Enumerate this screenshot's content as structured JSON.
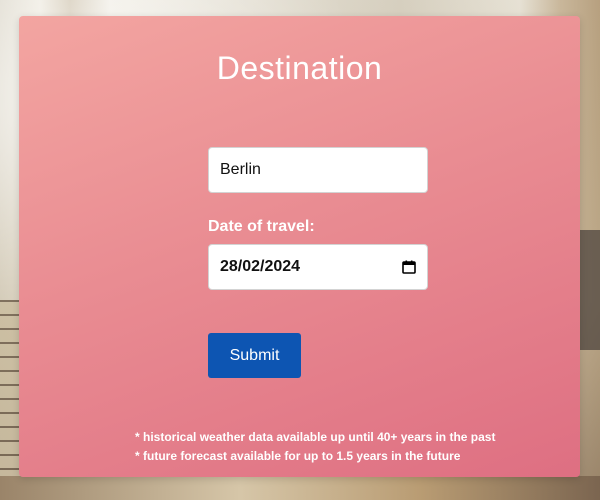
{
  "form": {
    "title": "Destination",
    "city_value": "Berlin",
    "date_label": "Date of travel:",
    "date_value": "28/02/2024",
    "submit_label": "Submit",
    "notes": [
      "* historical weather data available up until 40+ years in the past",
      "* future forecast available for up to 1.5 years in the future"
    ]
  },
  "icons": {
    "date_picker": "calendar-icon"
  },
  "colors": {
    "card_gradient_start": "#f3a5a1",
    "card_gradient_end": "#de6f82",
    "submit_button": "#0d55b2",
    "text_on_card": "#ffffff"
  }
}
